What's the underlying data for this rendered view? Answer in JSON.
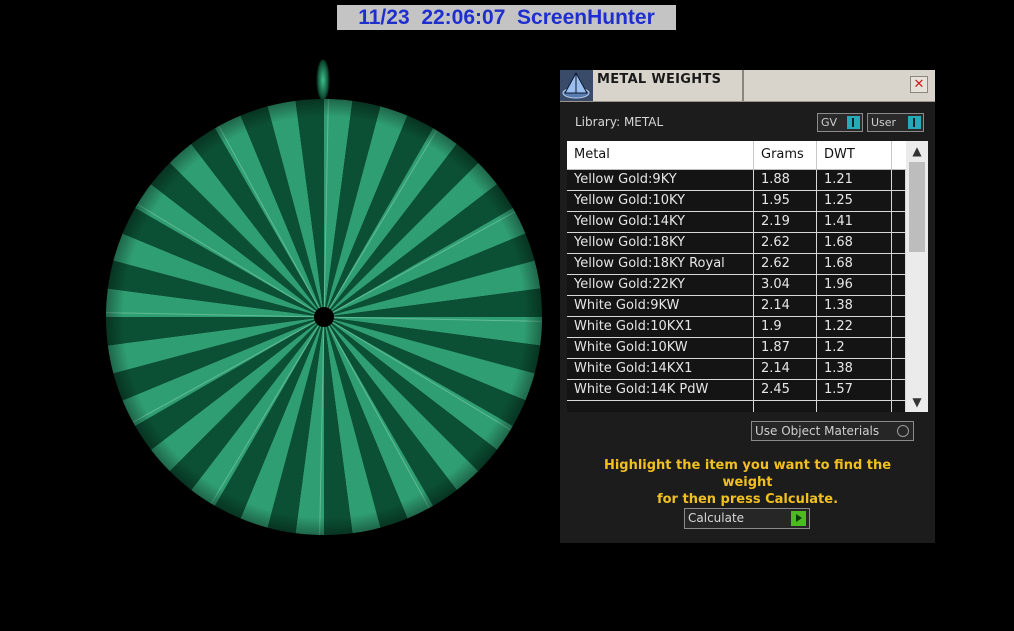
{
  "capture_banner": {
    "date": "11/23",
    "time": "22:06:07",
    "app": "ScreenHunter"
  },
  "panel": {
    "title": "METAL WEIGHTS",
    "close_label": "✕",
    "library_label": "Library: METAL",
    "toggle_gv": "GV",
    "toggle_user": "User",
    "columns": [
      "Metal",
      "Grams",
      "DWT"
    ],
    "rows": [
      {
        "metal": "Yellow Gold:9KY",
        "grams": "1.88",
        "dwt": "1.21"
      },
      {
        "metal": "Yellow Gold:10KY",
        "grams": "1.95",
        "dwt": "1.25"
      },
      {
        "metal": "Yellow Gold:14KY",
        "grams": "2.19",
        "dwt": "1.41"
      },
      {
        "metal": "Yellow Gold:18KY",
        "grams": "2.62",
        "dwt": "1.68"
      },
      {
        "metal": "Yellow Gold:18KY Royal",
        "grams": "2.62",
        "dwt": "1.68"
      },
      {
        "metal": "Yellow Gold:22KY",
        "grams": "3.04",
        "dwt": "1.96"
      },
      {
        "metal": "White Gold:9KW",
        "grams": "2.14",
        "dwt": "1.38"
      },
      {
        "metal": "White Gold:10KX1",
        "grams": "1.9",
        "dwt": "1.22"
      },
      {
        "metal": "White Gold:10KW",
        "grams": "1.87",
        "dwt": "1.2"
      },
      {
        "metal": "White Gold:14KX1",
        "grams": "2.14",
        "dwt": "1.38"
      },
      {
        "metal": "White Gold:14K PdW",
        "grams": "2.45",
        "dwt": "1.57"
      }
    ],
    "use_object_materials": "Use Object Materials",
    "instruction_line1": "Highlight the item you want to find the weight",
    "instruction_line2": "for then press Calculate.",
    "calculate_label": "Calculate"
  },
  "colors": {
    "pendant_light": "#2f9e72",
    "pendant_dark": "#0b5034",
    "instruction": "#f0c020",
    "banner_text": "#1f2fcf"
  }
}
